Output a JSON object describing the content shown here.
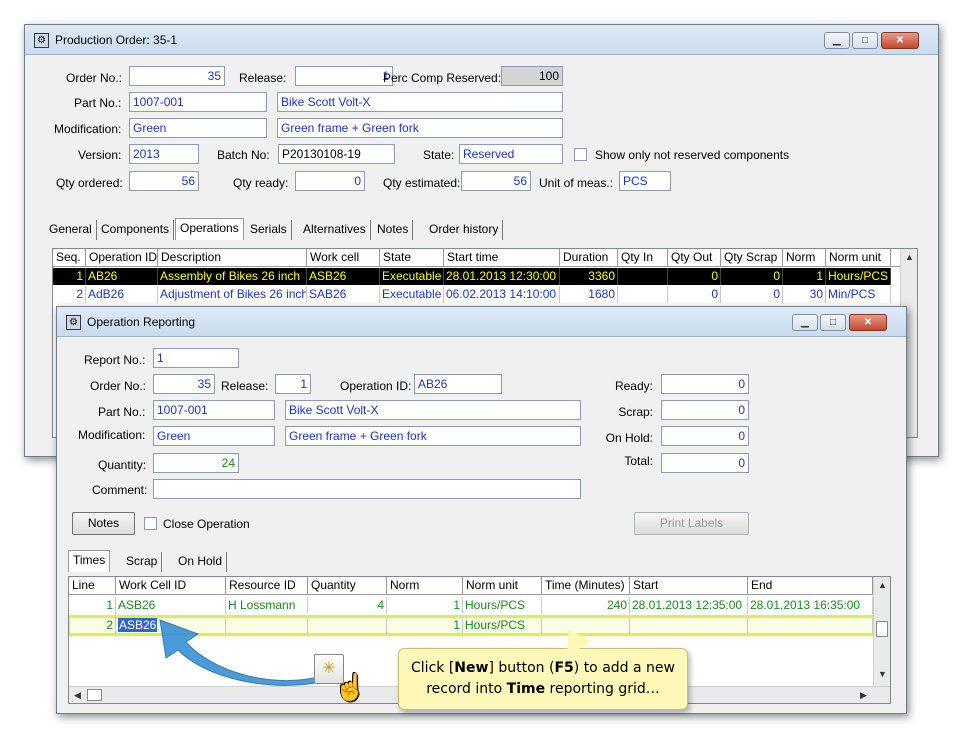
{
  "prod": {
    "title": "Production Order: 35-1",
    "order_no_label": "Order No.:",
    "order_no": "35",
    "release_label": "Release:",
    "release": "1",
    "perc_label": "Perc Comp Reserved:",
    "perc": "100",
    "part_no_label": "Part No.:",
    "part_no": "1007-001",
    "part_desc": "Bike Scott Volt-X",
    "mod_label": "Modification:",
    "mod": "Green",
    "mod_desc": "Green frame + Green fork",
    "version_label": "Version:",
    "version": "2013",
    "batch_label": "Batch No:",
    "batch": "P20130108-19",
    "state_label": "State:",
    "state": "Reserved",
    "show_only_label": "Show only not reserved components",
    "qty_ordered_label": "Qty ordered:",
    "qty_ordered": "56",
    "qty_ready_label": "Qty ready:",
    "qty_ready": "0",
    "qty_est_label": "Qty estimated:",
    "qty_est": "56",
    "uom_label": "Unit of meas.:",
    "uom": "PCS",
    "tabs": [
      "General",
      "Components",
      "Operations",
      "Serials",
      "Alternatives",
      "Notes",
      "Order history"
    ],
    "grid_headers": [
      "Seq.",
      "Operation ID",
      "Description",
      "Work cell",
      "State",
      "Start time",
      "Duration",
      "Qty In",
      "Qty Out",
      "Qty Scrap",
      "Norm",
      "Norm unit"
    ],
    "rows": [
      [
        "1",
        "AB26",
        "Assembly of Bikes 26 inch",
        "ASB26",
        "Executable",
        "28.01.2013 12:30:00",
        "3360",
        "",
        "0",
        "0",
        "1",
        "Hours/PCS"
      ],
      [
        "2",
        "AdB26",
        "Adjustment of Bikes 26 inch",
        "SAB26",
        "Executable",
        "06.02.2013 14:10:00",
        "1680",
        "",
        "0",
        "0",
        "30",
        "Min/PCS"
      ]
    ]
  },
  "oprep": {
    "title": "Operation Reporting",
    "report_no_label": "Report No.:",
    "report_no": "1",
    "order_no_label": "Order No.:",
    "order_no": "35",
    "release_label": "Release:",
    "release": "1",
    "op_id_label": "Operation ID:",
    "op_id": "AB26",
    "part_no_label": "Part No.:",
    "part_no": "1007-001",
    "part_desc": "Bike Scott Volt-X",
    "mod_label": "Modification:",
    "mod": "Green",
    "mod_desc": "Green frame + Green fork",
    "quantity_label": "Quantity:",
    "quantity": "24",
    "comment_label": "Comment:",
    "comment": "",
    "ready_label": "Ready:",
    "ready": "0",
    "scrap_label": "Scrap:",
    "scrap": "0",
    "onhold_label": "On Hold:",
    "onhold": "0",
    "total_label": "Total:",
    "total": "0",
    "notes_button": "Notes",
    "close_op_label": "Close Operation",
    "print_labels_button": "Print Labels",
    "tabs": [
      "Times",
      "Scrap",
      "On Hold"
    ],
    "grid_headers": [
      "Line",
      "Work Cell ID",
      "Resource ID",
      "Quantity",
      "Norm",
      "Norm unit",
      "Time (Minutes)",
      "Start",
      "End"
    ],
    "rows": [
      [
        "1",
        "ASB26",
        "H Lossmann",
        "4",
        "1",
        "Hours/PCS",
        "240",
        "28.01.2013 12:35:00",
        "28.01.2013 16:35:00"
      ],
      [
        "2",
        "ASB26",
        "",
        "",
        "1",
        "Hours/PCS",
        "",
        "",
        ""
      ]
    ]
  },
  "callout": {
    "line1_a": "Click [",
    "line1_b": "New",
    "line1_c": "] button (",
    "line1_d": "F5",
    "line1_e": ") to add a new",
    "line2_a": "record into ",
    "line2_b": "Time",
    "line2_c": " reporting grid…"
  },
  "colors": {
    "selected_row_bg": "#000000",
    "selected_row_fg": "#ffff00",
    "highlight": "#d9f24a",
    "callout_bg": "#fdf7b8",
    "arrow": "#3a93d6"
  }
}
